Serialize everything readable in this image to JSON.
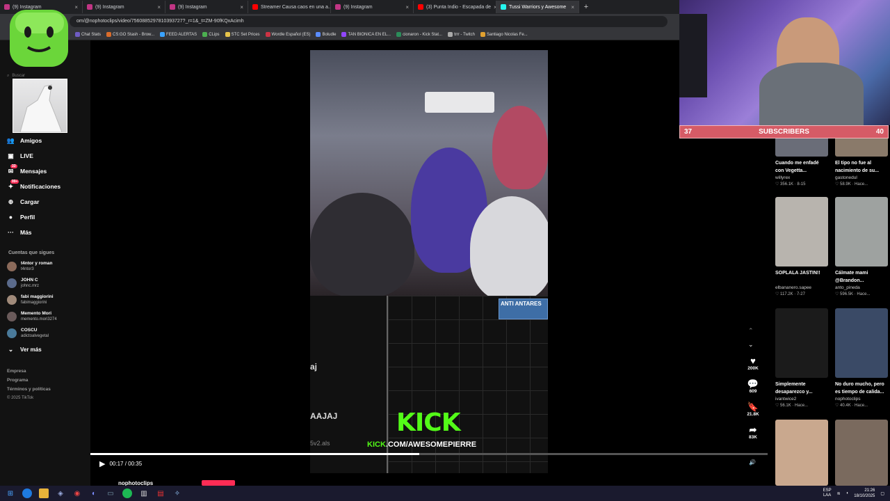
{
  "browser": {
    "tabs": [
      {
        "label": "(9) Instagram",
        "color": "#c13584",
        "active": false
      },
      {
        "label": "(9) Instagram",
        "color": "#c13584",
        "active": false
      },
      {
        "label": "(9) Instagram",
        "color": "#c13584",
        "active": false
      },
      {
        "label": "Streamer Causa caos en una a...",
        "color": "#ff0000",
        "active": false
      },
      {
        "label": "(9) Instagram",
        "color": "#c13584",
        "active": false
      },
      {
        "label": "(3) Punta Indio - Escapada de",
        "color": "#ff0000",
        "active": false
      },
      {
        "label": "Tussi Warriors y Awesome",
        "color": "#25f4ee",
        "active": true
      }
    ],
    "url": "om/@nophotoclips/video/7560885297810393727?_r=1&_t=ZM-90fKQxAcimh",
    "bookmarks": [
      "Chat Stats",
      "CS:GO Stash - Brow...",
      "FEED ALERTAS",
      "CLips",
      "STC Set Prices",
      "Wordle Español (ES)",
      "Boludle",
      "TAN BIONICA EN EL...",
      "cionaron - Kick Stat...",
      "trrr - Twitch",
      "Santiago Nicolas Fe..."
    ]
  },
  "sidebar": {
    "search_placeholder": "Buscar",
    "nav": [
      {
        "label": "Amigos",
        "icon": "friends-icon",
        "glyph": "👥"
      },
      {
        "label": "LIVE",
        "icon": "live-icon",
        "glyph": "▣"
      },
      {
        "label": "Mensajes",
        "icon": "messages-icon",
        "glyph": "✉",
        "badge": "33"
      },
      {
        "label": "Notificaciones",
        "icon": "notifications-icon",
        "glyph": "✦",
        "badge": "99+"
      },
      {
        "label": "Cargar",
        "icon": "upload-icon",
        "glyph": "⊕"
      },
      {
        "label": "Perfil",
        "icon": "profile-icon",
        "glyph": "●"
      },
      {
        "label": "Más",
        "icon": "more-icon",
        "glyph": "···"
      }
    ],
    "following_title": "Cuentas que sigues",
    "following": [
      {
        "name": "t4ntor y roman",
        "handle": "t4ntor3"
      },
      {
        "name": "JOHN C",
        "handle": "johnc.mrz"
      },
      {
        "name": "fabi maggiorini",
        "handle": "fabimaggiorini"
      },
      {
        "name": "Memento Mori",
        "handle": "memento.mori3274"
      },
      {
        "name": "COSCU",
        "handle": "adictoalvegetal"
      }
    ],
    "see_more": "Ver más",
    "footer": [
      "Empresa",
      "Programa",
      "Términos y políticas",
      "© 2025 TikTok"
    ]
  },
  "video": {
    "clip_label": "ANTI ANTARES",
    "track_text_1": "aj",
    "track_text_2": "AAJAJ",
    "track_text_3": "5v2.als",
    "kick_logo": "KICK",
    "kick_url_prefix": "KICK",
    "kick_url_rest": ".COM/AWESOMEPIERRE",
    "time": "00:17 / 00:35",
    "progress": 0.486,
    "author": "nophotoclips"
  },
  "actions": [
    {
      "icon": "heart-icon",
      "glyph": "♥",
      "count": "200K"
    },
    {
      "icon": "comment-icon",
      "glyph": "💬",
      "count": "609"
    },
    {
      "icon": "bookmark-icon",
      "glyph": "🔖",
      "count": "21.8K"
    },
    {
      "icon": "share-icon",
      "glyph": "➦",
      "count": "83K"
    }
  ],
  "recommendations": [
    {
      "title": "Cuando me enfadé con Vegetta...",
      "user": "willyrex",
      "meta": "♡ 356.1K · 8-15",
      "color": "#6a6d78"
    },
    {
      "title": "El tipo no fue al nacimiento de su...",
      "user": "gastonedul",
      "meta": "♡ 58.9K · Hace...",
      "color": "#8a7a6a"
    },
    {
      "title": "SOPLALA JASTIN!!",
      "user": "elbananero.sapee",
      "meta": "♡ 117.2K · 7-27",
      "color": "#b8b4ae"
    },
    {
      "title": "Cálmate mami @Brandon...",
      "user": "anto_pineda",
      "meta": "♡ 596.5K · Hace...",
      "color": "#9ea2a0"
    },
    {
      "title": "Simplemente desaparezco y...",
      "user": "ivantwice2",
      "meta": "♡ 56.1K · Hace...",
      "color": "#1b1b1b"
    },
    {
      "title": "No duro mucho, pero es tiempo de calida...",
      "user": "nophotoclips",
      "meta": "♡ 40.4K · Hace...",
      "color": "#3a4a66"
    },
    {
      "title": "",
      "user": "",
      "meta": "",
      "color": "#c9a88e"
    },
    {
      "title": "",
      "user": "",
      "meta": "",
      "color": "#7a6a5e"
    }
  ],
  "stream_overlay": {
    "sub_left": "37",
    "sub_label": "SUBSCRIBERS",
    "sub_right": "40"
  },
  "taskbar": {
    "lang": "ESP",
    "lang2": "LAA",
    "time": "21:26",
    "date": "18/10/2025"
  },
  "colors": {
    "tiktok_red": "#fe2c55",
    "kick_green": "#53fc18",
    "sub_bar": "#d65b66"
  }
}
